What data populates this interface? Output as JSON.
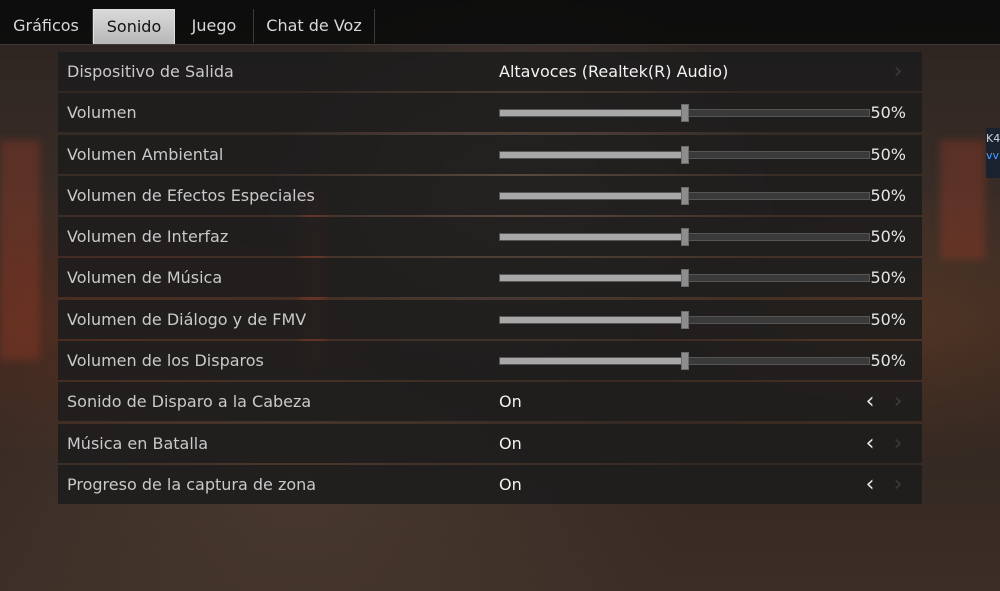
{
  "tabs": [
    {
      "label": "Gráficos",
      "active": false
    },
    {
      "label": "Sonido",
      "active": true
    },
    {
      "label": "Juego",
      "active": false
    },
    {
      "label": "Chat de Voz",
      "active": false
    }
  ],
  "side_text": {
    "line1": "K4",
    "line2": "vv"
  },
  "settings": [
    {
      "type": "select",
      "label": "Dispositivo de Salida",
      "value": "Altavoces (Realtek(R) Audio)",
      "arrow_left": "",
      "arrow_right": "›"
    },
    {
      "type": "slider",
      "label": "Volumen",
      "value": 0.5,
      "display": "50%"
    },
    {
      "type": "slider",
      "label": "Volumen Ambiental",
      "value": 0.5,
      "display": "50%"
    },
    {
      "type": "slider",
      "label": "Volumen de Efectos Especiales",
      "value": 0.5,
      "display": "50%"
    },
    {
      "type": "slider",
      "label": "Volumen de Interfaz",
      "value": 0.5,
      "display": "50%"
    },
    {
      "type": "slider",
      "label": "Volumen de Música",
      "value": 0.5,
      "display": "50%"
    },
    {
      "type": "slider",
      "label": "Volumen de Diálogo y de FMV",
      "value": 0.5,
      "display": "50%"
    },
    {
      "type": "slider",
      "label": "Volumen de los Disparos",
      "value": 0.5,
      "display": "50%"
    },
    {
      "type": "toggle",
      "label": "Sonido de Disparo a la Cabeza",
      "value": "On",
      "arrow_left": "‹",
      "arrow_right": "›"
    },
    {
      "type": "toggle",
      "label": "Música en Batalla",
      "value": "On",
      "arrow_left": "‹",
      "arrow_right": "›"
    },
    {
      "type": "toggle",
      "label": "Progreso de la captura de zona",
      "value": "On",
      "arrow_left": "‹",
      "arrow_right": "›"
    }
  ]
}
